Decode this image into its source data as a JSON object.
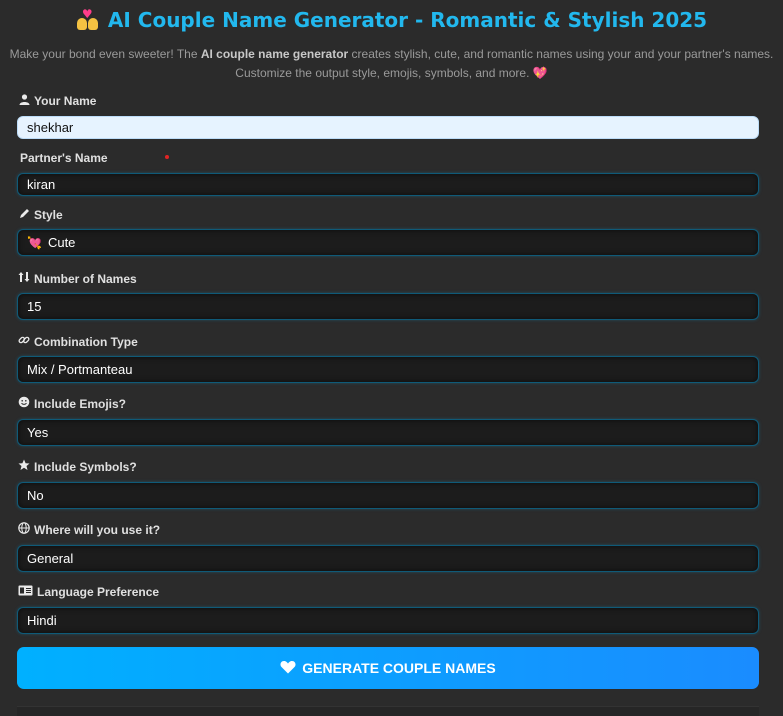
{
  "header": {
    "title": "AI Couple Name Generator - Romantic & Stylish 2025",
    "desc_pre": "Make your bond even sweeter! The ",
    "desc_bold": "AI couple name generator",
    "desc_post": " creates stylish, cute, and romantic names using your and your partner's names.",
    "desc_line2": "Customize the output style, emojis, symbols, and more.",
    "desc_emoji": "💖"
  },
  "form": {
    "your_name": {
      "label": "Your Name",
      "value": "shekhar"
    },
    "partner_name": {
      "label": "Partner's Name",
      "value": "kiran"
    },
    "style": {
      "label": "Style",
      "value": "Cute",
      "emoji": "💘"
    },
    "number_of_names": {
      "label": "Number of Names",
      "value": "15"
    },
    "combination_type": {
      "label": "Combination Type",
      "value": "Mix / Portmanteau"
    },
    "include_emojis": {
      "label": "Include Emojis?",
      "value": "Yes"
    },
    "include_symbols": {
      "label": "Include Symbols?",
      "value": "No"
    },
    "usage": {
      "label": "Where will you use it?",
      "value": "General"
    },
    "language": {
      "label": "Language Preference",
      "value": "Hindi"
    }
  },
  "actions": {
    "generate_label": "GENERATE COUPLE NAMES"
  },
  "icons": {
    "your_name": "user-icon",
    "style": "pencil-icon",
    "number": "sort-arrows-icon",
    "combination": "link-icon",
    "emojis": "smiley-icon",
    "symbols": "star-icon",
    "usage": "globe-icon",
    "language": "language-icon",
    "generate": "heart-icon"
  },
  "colors": {
    "accent": "#22b8ee",
    "button_start": "#00b0ff",
    "button_end": "#1a8cff",
    "background": "#2b2b2b",
    "required": "#e02424"
  }
}
